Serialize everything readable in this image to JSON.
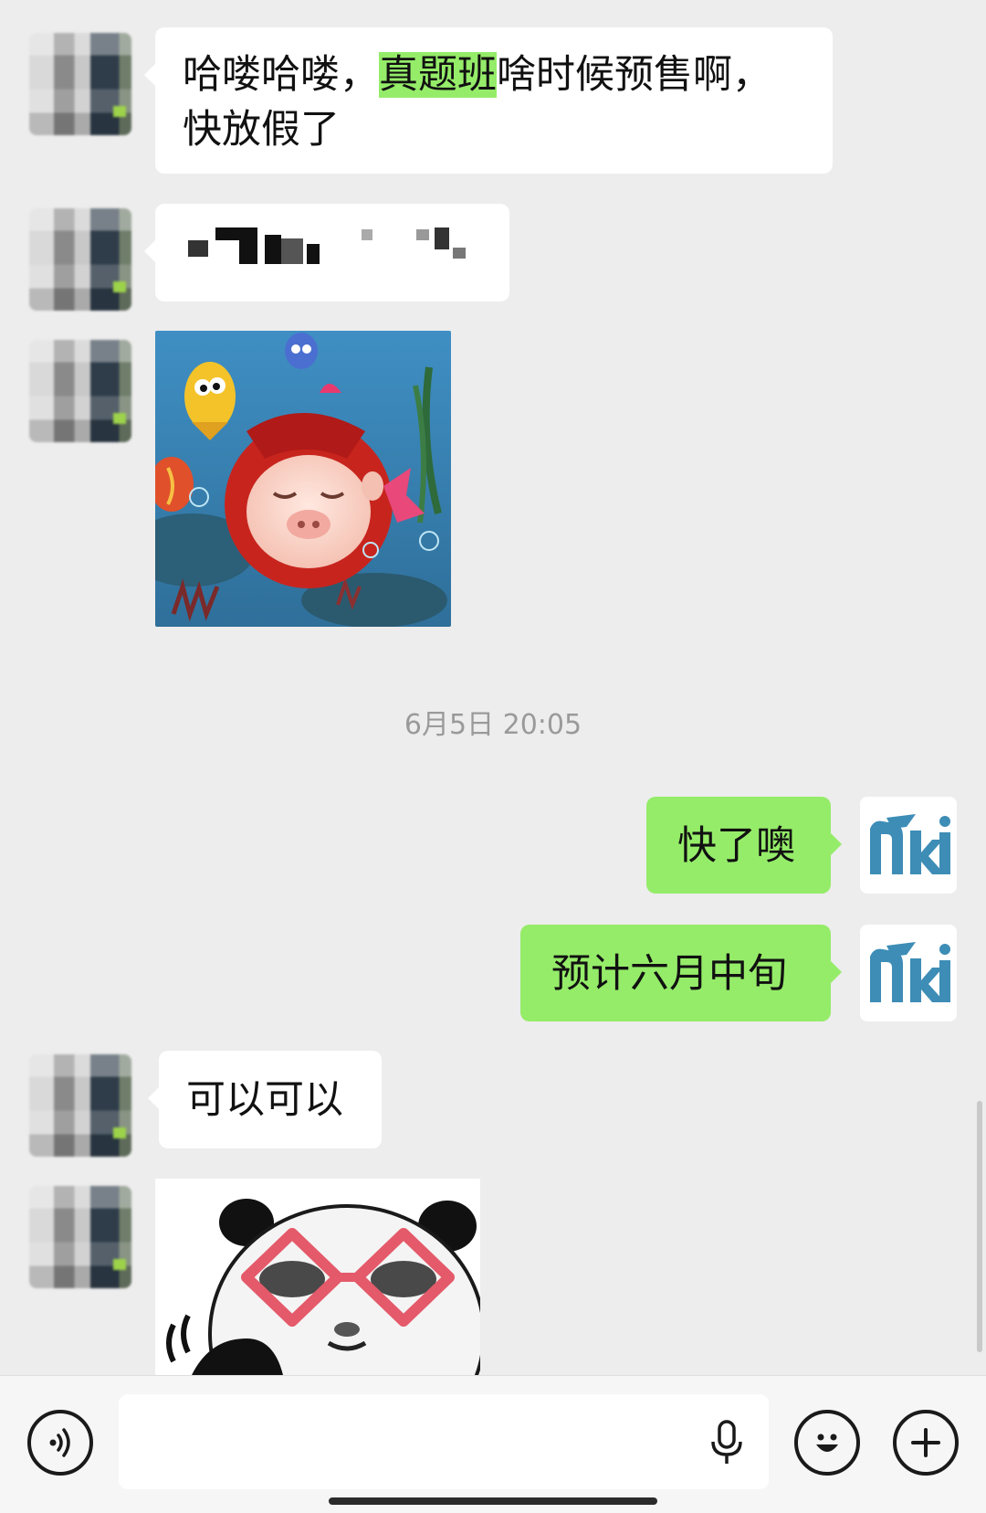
{
  "messages": [
    {
      "type": "text",
      "from": "other",
      "segments": [
        "哈喽哈喽，",
        "真题班",
        "啥时候预售啊，",
        "快放假了"
      ]
    },
    {
      "type": "pixelated-text",
      "from": "other"
    },
    {
      "type": "sticker",
      "from": "other",
      "icon": "pig-fish-sticker"
    },
    {
      "type": "timestamp",
      "text": "6月5日 20:05"
    },
    {
      "type": "text",
      "from": "me",
      "text": "快了噢"
    },
    {
      "type": "text",
      "from": "me",
      "text": "预计六月中旬"
    },
    {
      "type": "text",
      "from": "other",
      "text": "可以可以"
    },
    {
      "type": "sticker",
      "from": "other",
      "icon": "panda-glasses-sticker"
    }
  ],
  "colors": {
    "background": "#ededed",
    "incoming_bubble": "#ffffff",
    "outgoing_bubble": "#95ec69",
    "highlight": "#95ec69"
  },
  "inputbar": {
    "voice_icon": "voice-icon",
    "mic_icon": "microphone-icon",
    "emoji_icon": "emoji-icon",
    "plus_icon": "plus-icon"
  }
}
